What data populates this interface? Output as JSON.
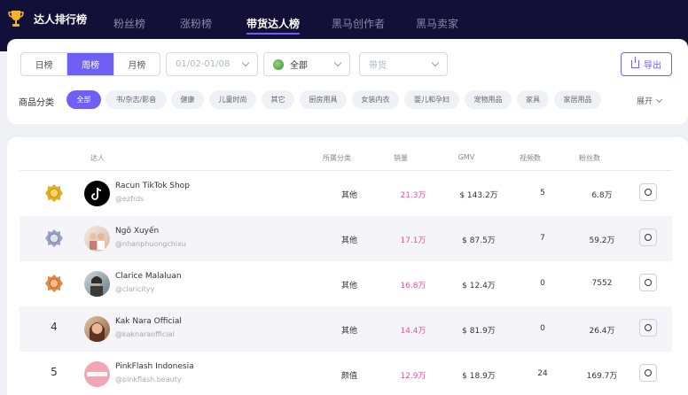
{
  "app": {
    "title": "达人排行榜"
  },
  "nav": {
    "tabs": [
      {
        "label": "粉丝榜"
      },
      {
        "label": "涨粉榜"
      },
      {
        "label": "带货达人榜"
      },
      {
        "label": "黑马创作者"
      },
      {
        "label": "黑马卖家"
      }
    ],
    "active_index": 2
  },
  "filters": {
    "periods": [
      "日榜",
      "周榜",
      "月榜"
    ],
    "active_period_index": 1,
    "date_range": "01/02-01/08",
    "country": "全部",
    "goods_placeholder": "带货",
    "export_label": "导出"
  },
  "categories": {
    "label": "商品分类",
    "items": [
      "全部",
      "书/杂志/影音",
      "健康",
      "儿童时尚",
      "其它",
      "厨房用具",
      "女装内衣",
      "婴儿和孕妇",
      "宠物用品",
      "家具",
      "家居用品"
    ],
    "active_index": 0,
    "expand_label": "展开"
  },
  "table": {
    "headers": {
      "creator": "达人",
      "category": "所属分类",
      "sales": "销量",
      "gmv": "GMV",
      "videos": "视频数",
      "fans": "粉丝数"
    },
    "rows": [
      {
        "rank": "1",
        "name": "Racun TikTok Shop",
        "handle": "@ezfrds",
        "category": "其他",
        "sales": "21.3万",
        "gmv": "$ 143.2万",
        "videos": "5",
        "fans": "6.8万",
        "badge": "gold",
        "avatar_text": "TIKTOK"
      },
      {
        "rank": "2",
        "name": "Ngô Xuyến",
        "handle": "@nhanphuongchixu",
        "category": "其他",
        "sales": "17.1万",
        "gmv": "$ 87.5万",
        "videos": "7",
        "fans": "59.2万",
        "badge": "silver",
        "avatar_text": ""
      },
      {
        "rank": "3",
        "name": "Clarice Malaluan",
        "handle": "@claricityy",
        "category": "其他",
        "sales": "16.8万",
        "gmv": "$ 12.4万",
        "videos": "0",
        "fans": "7552",
        "badge": "bronze",
        "avatar_text": ""
      },
      {
        "rank": "4",
        "name": "Kak Nara Official",
        "handle": "@kaknaraofficial",
        "category": "其他",
        "sales": "14.4万",
        "gmv": "$ 81.9万",
        "videos": "0",
        "fans": "26.4万",
        "badge": "",
        "avatar_text": ""
      },
      {
        "rank": "5",
        "name": "PinkFlash Indonesia",
        "handle": "@pinkflash.beauty",
        "category": "颜值",
        "sales": "12.9万",
        "gmv": "$ 18.9万",
        "videos": "24",
        "fans": "169.7万",
        "badge": "",
        "avatar_text": "PINKFLASH"
      }
    ]
  },
  "colors": {
    "nav_bg": "#120f38",
    "accent": "#6e5ff5",
    "sales_pink": "#e0559a",
    "gold": "#e0b020",
    "silver": "#9aa3c4",
    "bronze": "#e08a4a"
  },
  "icons": {
    "brand": "trophy-icon",
    "export": "export-icon",
    "view": "view-icon",
    "dropdown": "chevron-down-icon",
    "country": "globe-icon"
  }
}
